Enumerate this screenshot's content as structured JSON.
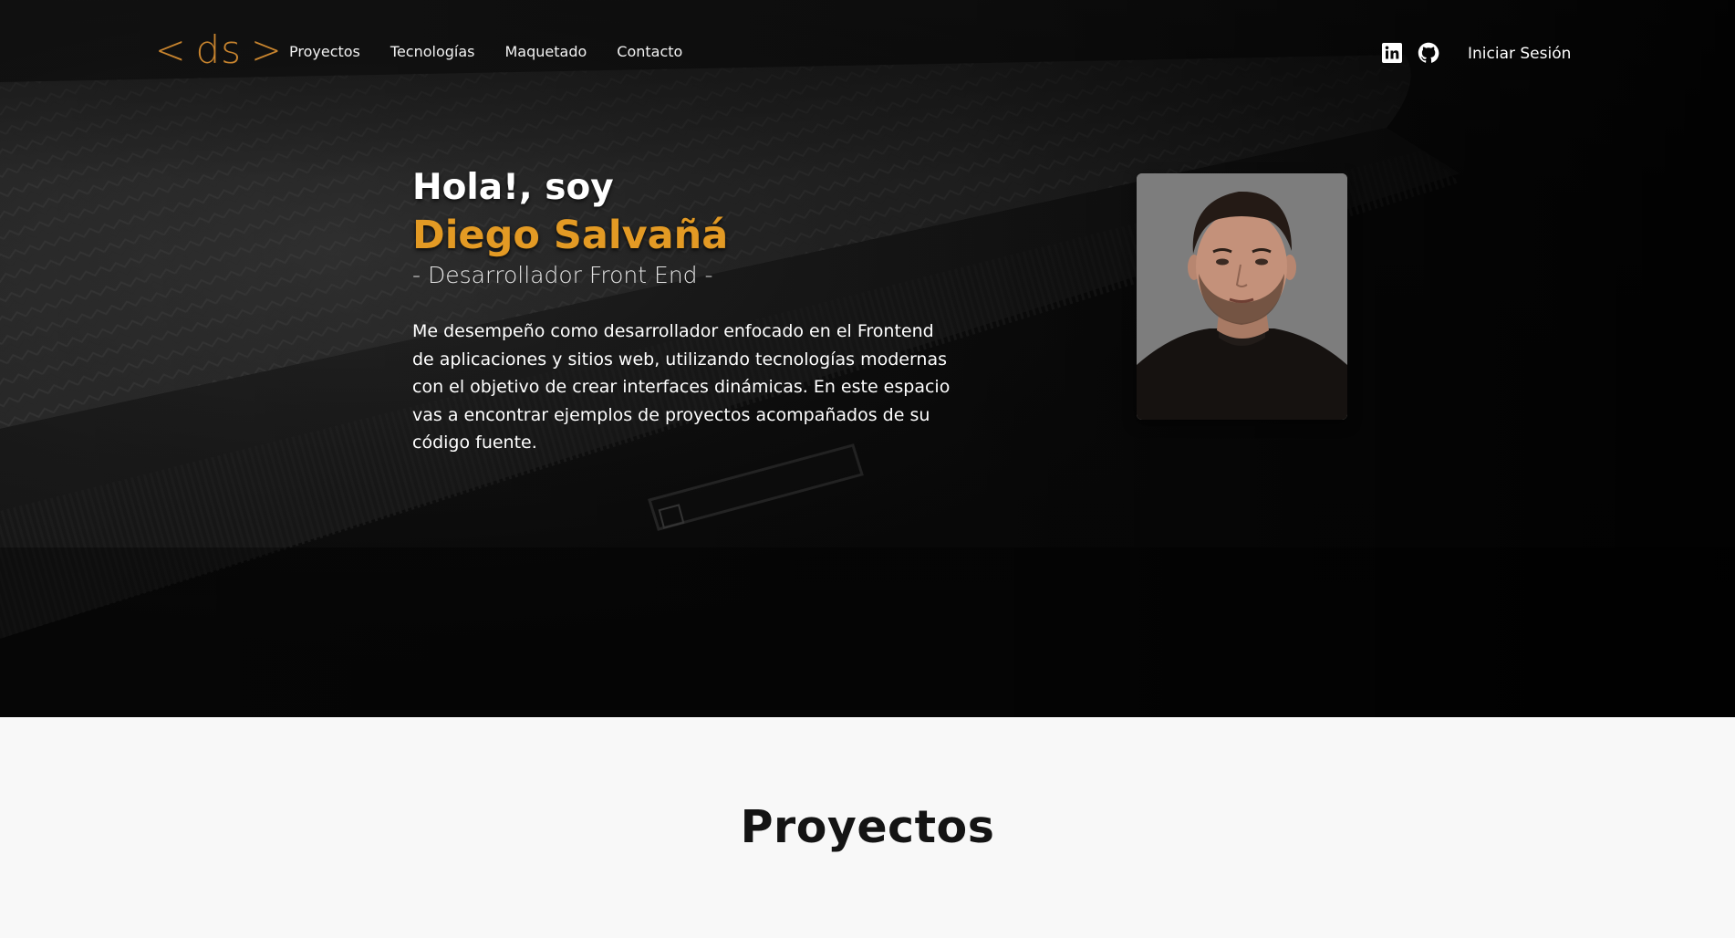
{
  "header": {
    "logo": {
      "left": "<",
      "text": "ds",
      "right": ">"
    },
    "nav": [
      "Proyectos",
      "Tecnologías",
      "Maquetado",
      "Contacto"
    ],
    "socials": [
      {
        "name": "linkedin-icon",
        "label": "LinkedIn"
      },
      {
        "name": "github-icon",
        "label": "GitHub"
      }
    ],
    "login_label": "Iniciar Sesión"
  },
  "hero": {
    "greeting": "Hola!, soy",
    "name": "Diego Salvañá",
    "role": "- Desarrollador Front End -",
    "bio": "Me desempeño como desarrollador enfocado en el Frontend de aplicaciones y sitios web, utilizando tecnologías modernas con el objetivo de crear interfaces dinámicas. En este espacio vas a encontrar ejemplos de proyectos acompañados de su código fuente."
  },
  "projects": {
    "title": "Proyectos"
  },
  "colors": {
    "accent": "#e39a24",
    "logo": "#c8842e",
    "hero_bg": "#060606",
    "section_bg": "#f8f8f8"
  }
}
